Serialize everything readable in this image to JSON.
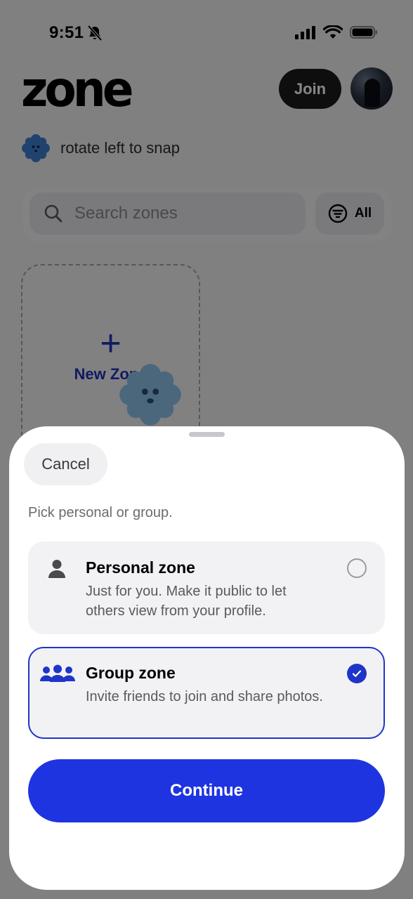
{
  "status_bar": {
    "time": "9:51"
  },
  "header": {
    "logo": "zone",
    "join_label": "Join"
  },
  "hint": {
    "text": "rotate left to snap"
  },
  "search": {
    "placeholder": "Search zones",
    "filter_label": "All"
  },
  "new_zone": {
    "label": "New Zone",
    "plus": "+"
  },
  "sheet": {
    "cancel_label": "Cancel",
    "prompt": "Pick personal or group.",
    "options": [
      {
        "title": "Personal zone",
        "description": "Just for you. Make it public to let others view from your profile.",
        "selected": false
      },
      {
        "title": "Group zone",
        "description": "Invite friends to join and share photos.",
        "selected": true
      }
    ],
    "continue_label": "Continue"
  },
  "colors": {
    "accent": "#1E34E0",
    "mascot": "#3D7FD0",
    "dark": "#1B1B1B"
  },
  "icons": [
    "bell-slash-icon",
    "signal-icon",
    "wifi-icon",
    "battery-icon",
    "mascot-icon",
    "search-icon",
    "filter-icon",
    "person-icon",
    "group-icon",
    "checkmark-icon"
  ]
}
